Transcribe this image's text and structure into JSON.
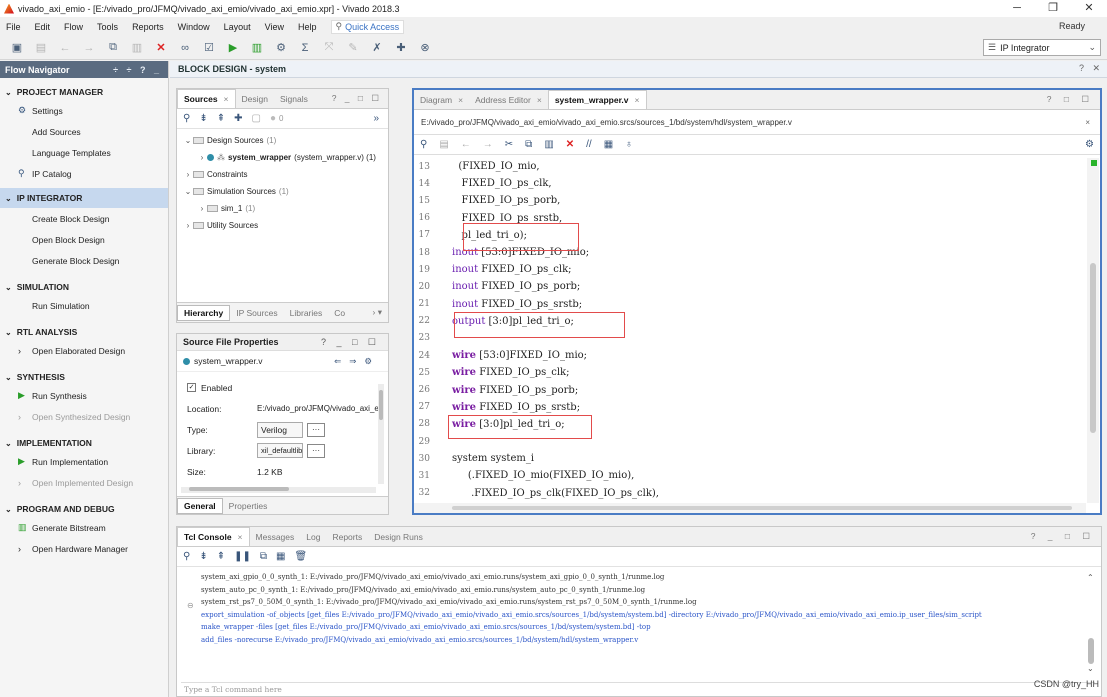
{
  "window": {
    "title": "vivado_axi_emio - [E:/vivado_pro/JFMQ/vivado_axi_emio/vivado_axi_emio.xpr] - Vivado 2018.3",
    "controls": [
      "─",
      "❐",
      "✕"
    ]
  },
  "menu": {
    "items": [
      "File",
      "Edit",
      "Flow",
      "Tools",
      "Reports",
      "Window",
      "Layout",
      "View",
      "Help"
    ],
    "quick_access": "Quick Access",
    "status": "Ready"
  },
  "toolbar": {
    "layout_select": "IP Integrator"
  },
  "flow_navigator": {
    "title": "Flow Navigator",
    "header_controls": "÷ ÷ ? _",
    "sections": [
      {
        "label": "PROJECT MANAGER",
        "items": [
          "Settings",
          "Add Sources",
          "Language Templates",
          "IP Catalog"
        ]
      },
      {
        "label": "IP INTEGRATOR",
        "items": [
          "Create Block Design",
          "Open Block Design",
          "Generate Block Design"
        ]
      },
      {
        "label": "SIMULATION",
        "items": [
          "Run Simulation"
        ]
      },
      {
        "label": "RTL ANALYSIS",
        "items": [
          "Open Elaborated Design"
        ]
      },
      {
        "label": "SYNTHESIS",
        "items": [
          "Run Synthesis",
          "Open Synthesized Design"
        ]
      },
      {
        "label": "IMPLEMENTATION",
        "items": [
          "Run Implementation",
          "Open Implemented Design"
        ]
      },
      {
        "label": "PROGRAM AND DEBUG",
        "items": [
          "Generate Bitstream",
          "Open Hardware Manager"
        ]
      }
    ]
  },
  "block_design": {
    "title": "BLOCK DESIGN - system",
    "controls": "? ✕"
  },
  "sources": {
    "tabs": [
      "Sources",
      "Design",
      "Signals"
    ],
    "tab_controls": "? _ □ ☐",
    "badge": "0",
    "tree": {
      "design_sources": "Design Sources",
      "design_sources_count": "(1)",
      "top_name": "system_wrapper",
      "top_detail": "(system_wrapper.v) (1)",
      "constraints": "Constraints",
      "sim_sources": "Simulation Sources",
      "sim_sources_count": "(1)",
      "sim1": "sim_1",
      "sim1_count": "(1)",
      "utility": "Utility Sources"
    },
    "bottom_tabs": [
      "Hierarchy",
      "IP Sources",
      "Libraries",
      "Co"
    ]
  },
  "properties": {
    "title": "Source File Properties",
    "controls": "? _ □ ☐",
    "file": "system_wrapper.v",
    "enabled_label": "Enabled",
    "rows": [
      {
        "label": "Location:",
        "value": "E:/vivado_pro/JFMQ/vivado_axi_e"
      },
      {
        "label": "Type:",
        "value": "Verilog"
      },
      {
        "label": "Library:",
        "value": "xil_defaultlib"
      },
      {
        "label": "Size:",
        "value": "1.2 KB"
      }
    ],
    "tabs": [
      "General",
      "Properties"
    ]
  },
  "editor": {
    "tabs": [
      "Diagram",
      "Address Editor",
      "system_wrapper.v"
    ],
    "controls": "? □ ☐",
    "path": "E:/vivado_pro/JFMQ/vivado_axi_emio/vivado_axi_emio.srcs/sources_1/bd/system/hdl/system_wrapper.v",
    "lines": [
      {
        "n": "13",
        "kw": "",
        "text": "  (FIXED_IO_mio,"
      },
      {
        "n": "14",
        "kw": "",
        "text": "   FIXED_IO_ps_clk,"
      },
      {
        "n": "15",
        "kw": "",
        "text": "   FIXED_IO_ps_porb,"
      },
      {
        "n": "16",
        "kw": "",
        "text": "   FIXED_IO_ps_srstb,"
      },
      {
        "n": "17",
        "kw": "",
        "text": "   pl_led_tri_o);"
      },
      {
        "n": "18",
        "kw": "inout",
        "text": " [53:0]FIXED_IO_mio;"
      },
      {
        "n": "19",
        "kw": "inout",
        "text": " FIXED_IO_ps_clk;"
      },
      {
        "n": "20",
        "kw": "inout",
        "text": " FIXED_IO_ps_porb;"
      },
      {
        "n": "21",
        "kw": "inout",
        "text": " FIXED_IO_ps_srstb;"
      },
      {
        "n": "22",
        "kw": "output",
        "text": " [3:0]pl_led_tri_o;"
      },
      {
        "n": "23",
        "kw": "",
        "text": ""
      },
      {
        "n": "24",
        "kw": "wire",
        "text": " [53:0]FIXED_IO_mio;"
      },
      {
        "n": "25",
        "kw": "wire",
        "text": " FIXED_IO_ps_clk;"
      },
      {
        "n": "26",
        "kw": "wire",
        "text": " FIXED_IO_ps_porb;"
      },
      {
        "n": "27",
        "kw": "wire",
        "text": " FIXED_IO_ps_srstb;"
      },
      {
        "n": "28",
        "kw": "wire",
        "text": " [3:0]pl_led_tri_o;"
      },
      {
        "n": "29",
        "kw": "",
        "text": ""
      },
      {
        "n": "30",
        "kw": "",
        "text": "system system_i"
      },
      {
        "n": "31",
        "kw": "",
        "text": "     (.FIXED_IO_mio(FIXED_IO_mio),"
      },
      {
        "n": "32",
        "kw": "",
        "text": "      .FIXED_IO_ps_clk(FIXED_IO_ps_clk),"
      }
    ]
  },
  "tcl": {
    "tabs": [
      "Tcl Console",
      "Messages",
      "Log",
      "Reports",
      "Design Runs"
    ],
    "controls": "? _ □ ☐",
    "lines": [
      {
        "color": "blk",
        "text": "system_axi_gpio_0_0_synth_1: E:/vivado_pro/JFMQ/vivado_axi_emio/vivado_axi_emio.runs/system_axi_gpio_0_0_synth_1/runme.log"
      },
      {
        "color": "blk",
        "text": "system_auto_pc_0_synth_1: E:/vivado_pro/JFMQ/vivado_axi_emio/vivado_axi_emio.runs/system_auto_pc_0_synth_1/runme.log"
      },
      {
        "color": "blk",
        "text": "system_rst_ps7_0_50M_0_synth_1: E:/vivado_pro/JFMQ/vivado_axi_emio/vivado_axi_emio.runs/system_rst_ps7_0_50M_0_synth_1/runme.log"
      },
      {
        "color": "blue",
        "text": "export_simulation -of_objects [get_files E:/vivado_pro/JFMQ/vivado_axi_emio/vivado_axi_emio.srcs/sources_1/bd/system/system.bd] -directory E:/vivado_pro/JFMQ/vivado_axi_emio/vivado_axi_emio.ip_user_files/sim_script"
      },
      {
        "color": "blue",
        "text": "make_wrapper -files [get_files E:/vivado_pro/JFMQ/vivado_axi_emio/vivado_axi_emio.srcs/sources_1/bd/system/system.bd] -top"
      },
      {
        "color": "blue",
        "text": "add_files -norecurse E:/vivado_pro/JFMQ/vivado_axi_emio/vivado_axi_emio.srcs/sources_1/bd/system/hdl/system_wrapper.v"
      }
    ],
    "input_placeholder": "Type a Tcl command here"
  },
  "watermark": "CSDN @try_HH"
}
